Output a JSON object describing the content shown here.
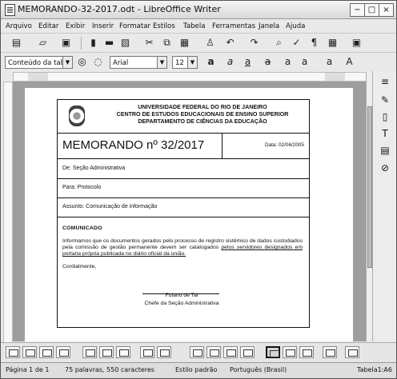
{
  "window": {
    "title": "MEMORANDO-32-2017.odt - LibreOffice Writer",
    "controls": {
      "minimize": "−",
      "maximize": "□",
      "close": "×"
    }
  },
  "menu": [
    "Arquivo",
    "Editar",
    "Exibir",
    "Inserir",
    "Formatar",
    "Estilos",
    "Tabela",
    "Ferramentas",
    "Janela",
    "Ajuda"
  ],
  "toolbar": {
    "paragraph_style": "Conteúdo da tab",
    "font_name": "Arial",
    "font_size": "12",
    "icons": [
      "new-document-icon",
      "open-folder-icon",
      "save-icon",
      "export-pdf-icon",
      "print-icon",
      "print-preview-icon",
      "cut-icon",
      "copy-icon",
      "paste-icon",
      "clone-formatting-icon",
      "undo-icon",
      "redo-icon",
      "find-replace-icon",
      "spelling-icon",
      "formatting-marks-icon",
      "insert-table-icon",
      "insert-image-icon"
    ]
  },
  "document": {
    "university": "UNIVERSIDADE FEDERAL DO RIO DE JANEIRO",
    "center": "CENTRO DE ESTUDOS EDUCACIONAIS DE ENSINO SUPERIOR",
    "department": "DEPARTAMENTO DE CIÊNCIAS DA EDUCAÇÃO",
    "memo_title": "MEMORANDO nº 32/2017",
    "date": "Data: 02/06/2005",
    "from": "De: Seção Administrativa",
    "to": "Para: Protocolo",
    "subject": "Assunto: Comunicação de informação",
    "communication_heading": "COMUNICADO",
    "body": "Informamos que os documentos gerados pelo processo de registro sistêmico de dados custodiados pela comissão de gestão permanente devem ser catalogados",
    "body_underlined": "pelos servidores designados em portaria própria publicada no diário oficial da união.",
    "closing": "Cordialmente,",
    "signature_name": "Fulano de Tal",
    "signature_role": "Chefe da Seção Administrativa"
  },
  "status": {
    "page": "Página 1 de 1",
    "words": "75 palavras, 550 caracteres",
    "style": "Estilo padrão",
    "language": "Português (Brasil)",
    "selection": "Tabela1:A6"
  }
}
